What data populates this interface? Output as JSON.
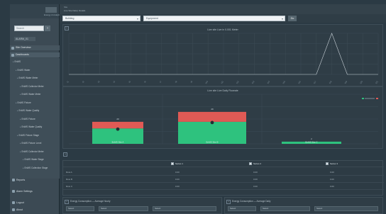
{
  "sidebar": {
    "logo_sub": "Energy & Analytics",
    "search_placeholder": "Search",
    "search_btn": "›",
    "user_label": "ALARM_01",
    "section_site": "Site Overview",
    "section_tree": "Dashboards",
    "tree_items": [
      "EnMS",
      "EnMS Water",
      "EnMS Water Meter",
      "EnMS Collector Meter",
      "EnMS Water Meter",
      "EnMS Fixture",
      "EnMS Water Quality",
      "EnMS Fixture",
      "EnMS Water Quality",
      "EnMS Fixture Stage",
      "EnMS Fixture Level",
      "EnMS Collector Meter",
      "EnMS Water Stage",
      "EnMS Collection Stage"
    ],
    "footer_items": [
      "Reports",
      "Alarm Settings",
      "Logout",
      "About"
    ]
  },
  "header": {
    "breadcrumb": "Site",
    "subtitle": "Live Site Data | Details"
  },
  "filters": {
    "select_a": "Building",
    "select_b": "Equipment",
    "go_label": "Go"
  },
  "charts": {
    "line_title": "Live site Live in 0.001 Meter",
    "bar_title": "Live site Live Daily Flowrate"
  },
  "chart_data": [
    {
      "type": "line",
      "title": "Live site Live in 0.001 Meter",
      "x": [
        "t1",
        "t2",
        "t3",
        "t4",
        "t5",
        "t6",
        "t7",
        "t8",
        "t9",
        "t10",
        "t11",
        "t12",
        "t13",
        "t14",
        "t15",
        "t16",
        "t17",
        "t18",
        "t19",
        "t20",
        "t21"
      ],
      "series": [
        {
          "values": [
            0,
            0,
            0,
            0,
            0,
            0,
            0,
            0,
            0,
            0,
            0,
            0,
            0,
            0,
            0,
            0,
            0,
            1,
            0,
            0,
            0
          ]
        }
      ],
      "ylim": [
        0,
        1
      ],
      "grid": true
    },
    {
      "type": "bar",
      "title": "Live site Live Daily Flowrate",
      "categories": [
        "EnMS Site A",
        "EnMS Site B",
        "EnMS Site C"
      ],
      "series": [
        {
          "values": [
            14,
            20,
            2
          ],
          "color": "#2ec27e"
        },
        {
          "values": [
            6,
            9,
            0
          ],
          "color": "#e05a55"
        }
      ],
      "data_labels": [
        "20",
        "29",
        "2"
      ],
      "grid": true
    }
  ],
  "legend": {
    "green": "",
    "red": ""
  },
  "table": {
    "headers": [
      "",
      "Series 1",
      "Series 2",
      "Series 3"
    ],
    "rows": [
      [
        "Row A",
        "0.00",
        "0.00",
        "0.00"
      ],
      [
        "Row B",
        "0.00",
        "0.00",
        "0.00"
      ],
      [
        "Row C",
        "0.00",
        "0.00",
        "0.00"
      ]
    ]
  },
  "bottom": {
    "left_title": "Energy Consumption — Average Hourly",
    "right_title": "Energy Consumption — Average Daily",
    "left_selects": [
      "Select",
      "Select",
      "Select"
    ],
    "right_selects": [
      "Select",
      "Select",
      "Select"
    ]
  },
  "colors": {
    "bg": "#2b3a44",
    "green": "#2ec27e",
    "red": "#e05a55"
  }
}
